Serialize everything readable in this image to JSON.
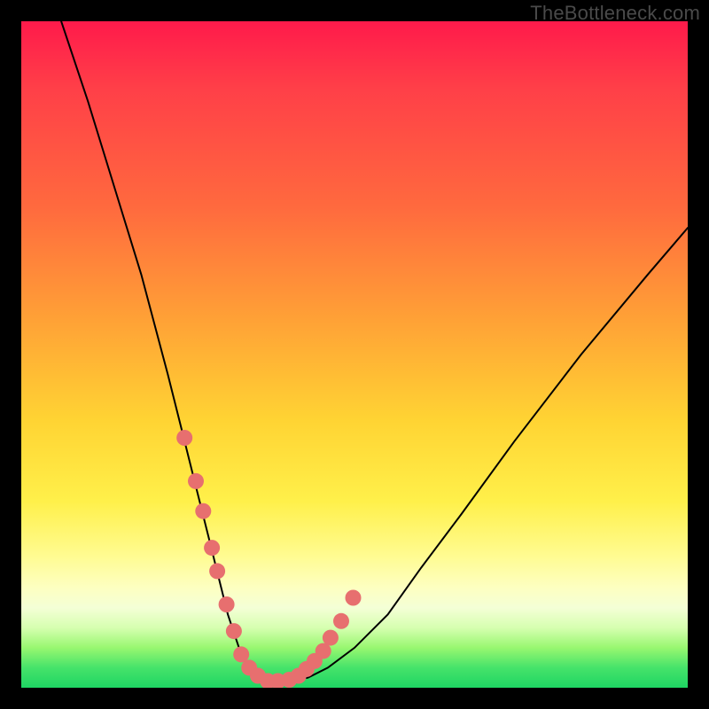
{
  "watermark": "TheBottleneck.com",
  "colors": {
    "frame": "#000000",
    "curve": "#000000",
    "marker_fill": "#e76f6f",
    "marker_stroke": "#c55a5a",
    "gradient_top": "#ff1a4b",
    "gradient_bottom": "#1ed563"
  },
  "chart_data": {
    "type": "line",
    "title": "",
    "xlabel": "",
    "ylabel": "",
    "xlim": [
      0,
      100
    ],
    "ylim": [
      0,
      100
    ],
    "grid": false,
    "legend": false,
    "series": [
      {
        "name": "bottleneck-curve",
        "x": [
          6,
          10,
          14,
          18,
          22,
          24,
          26,
          28,
          29,
          30,
          31,
          32,
          33,
          34,
          35,
          36,
          38,
          40,
          43,
          46,
          50,
          55,
          60,
          66,
          74,
          84,
          94,
          100
        ],
        "y": [
          100,
          88,
          75,
          62,
          47,
          39,
          31,
          23,
          19,
          15,
          11,
          8,
          5,
          3,
          2,
          1.5,
          1,
          1,
          1.5,
          3,
          6,
          11,
          18,
          26,
          37,
          50,
          62,
          69
        ]
      }
    ],
    "markers": {
      "name": "highlighted-points",
      "x": [
        24.5,
        26.2,
        27.3,
        28.6,
        29.4,
        30.8,
        31.9,
        33.0,
        34.2,
        35.5,
        37.0,
        38.5,
        40.2,
        41.6,
        42.8,
        44.0,
        45.3,
        46.4,
        48.0,
        49.8
      ],
      "y": [
        37.5,
        31.0,
        26.5,
        21.0,
        17.5,
        12.5,
        8.5,
        5.0,
        3.0,
        1.8,
        1.0,
        1.0,
        1.2,
        1.8,
        2.8,
        4.0,
        5.5,
        7.5,
        10.0,
        13.5
      ]
    }
  }
}
